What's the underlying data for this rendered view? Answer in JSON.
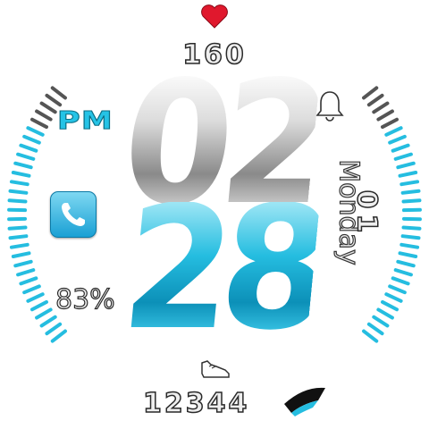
{
  "watch_face": {
    "heart_rate": "160",
    "ampm": "PM",
    "time": {
      "hours": "02",
      "minutes": "28"
    },
    "date": {
      "weekday": "Monday",
      "day": "01"
    },
    "battery": "83%",
    "steps": "12344",
    "step_goal_progress": 0.15,
    "battery_level": 0.83,
    "icons": [
      "heart-icon",
      "bell-icon",
      "phone-icon",
      "shoe-icon"
    ],
    "colors": {
      "accent": "#25bde0",
      "heart": "#e0182d",
      "tick_inactive": "#555555",
      "background": "#ffffff"
    }
  }
}
